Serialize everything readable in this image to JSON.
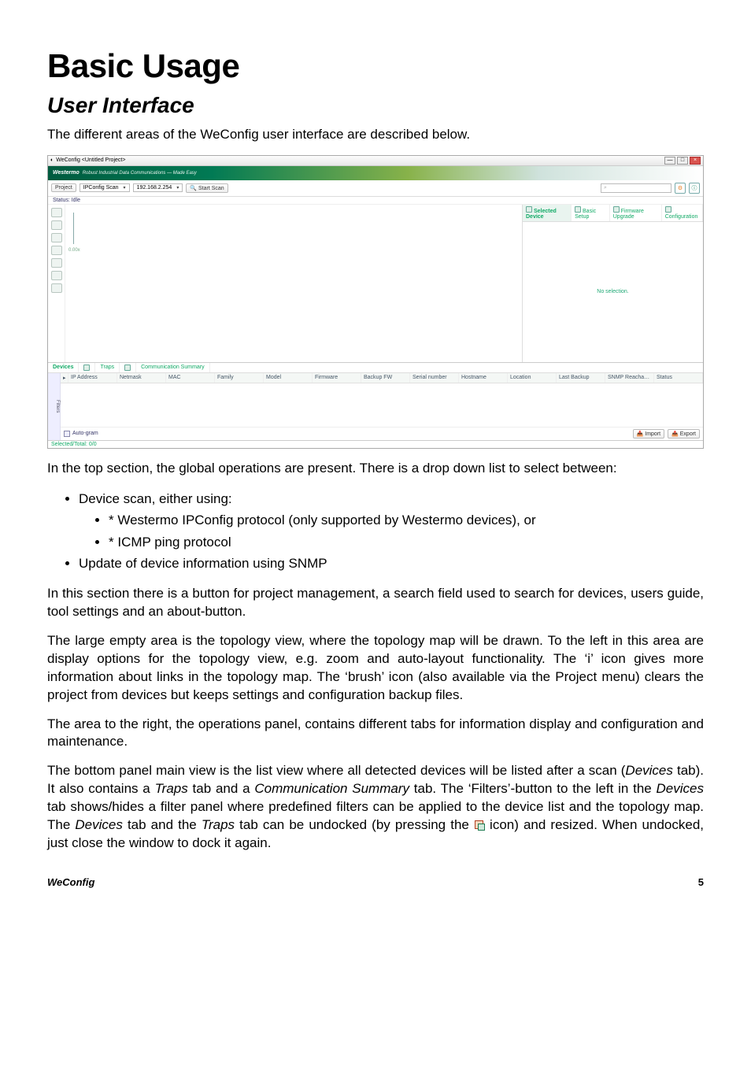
{
  "headings": {
    "h1": "Basic Usage",
    "h2": "User Interface"
  },
  "paragraphs": {
    "intro": "The different areas of the WeConfig user interface are described below.",
    "top_section_intro": "In the top section, the global operations are present. There is a drop down list to select between:",
    "top_section_note": "In this section there is a button for project management, a search field used to search for devices, users guide, tool settings and an about-button.",
    "large_area": "The large empty area is the topology view, where the topology map will be drawn. To the left in this area are display options for the topology view, e.g. zoom and auto-layout functionality. The ‘i’ icon gives more information about links in the topology map. The ‘brush’ icon (also available via the Project menu) clears the project from devices but keeps settings and configuration backup files.",
    "right_area": "The area to the right, the operations panel, contains different tabs for information display and configuration and maintenance.",
    "bottom_intro_1": "The bottom panel main view is the list view where all detected devices will be listed after a scan (",
    "bottom_devices_1": "Devices",
    "bottom_intro_2": " tab). It also contains a ",
    "bottom_traps": "Traps",
    "bottom_intro_3": " tab and a ",
    "bottom_comm": "Communication Summary",
    "bottom_intro_4": " tab. The ‘Filters’-button to the left in the ",
    "bottom_devices_2": "Devices",
    "bottom_intro_5": " tab shows/hides a filter panel where predefined filters can be applied to the device list and the topology map. The ",
    "bottom_devices_3": "Devices",
    "bottom_intro_6": " tab and the ",
    "bottom_traps_2": "Traps",
    "bottom_intro_7": " tab can be undocked (by pressing the ",
    "bottom_intro_8": " icon) and resized. When undocked, just close the window to dock it again."
  },
  "list": {
    "device_scan": "Device scan, either using:",
    "sub_ipconfig": "Westermo IPConfig protocol (only supported by Westermo devices), or",
    "sub_icmp": "ICMP ping protocol",
    "update_snmp": "Update of device information using SNMP"
  },
  "footer": {
    "product": "WeConfig",
    "page": "5"
  },
  "app": {
    "title": "WeConfig <Untitled Project>",
    "brand": "Westermo",
    "tagline": "Robust Industrial Data Communications — Made Easy",
    "toolbar": {
      "project": "Project",
      "scan_mode": "IPConfig Scan",
      "scan_target": "192.168.2.254",
      "start_scan": "Start Scan",
      "search_placeholder": " "
    },
    "status_idle": "Status:  Idle",
    "topo_scale": "0.00x",
    "right_tabs": {
      "selected": "Selected Device",
      "basic": "Basic Setup",
      "firmware": "Firmware Upgrade",
      "config": "Configuration"
    },
    "right_body": "No selection.",
    "bottom_tabs": {
      "devices": "Devices",
      "traps": "Traps",
      "comm": "Communication Summary"
    },
    "columns": [
      "IP Address",
      "Netmask",
      "MAC",
      "Family",
      "Model",
      "Firmware",
      "Backup FW",
      "Serial number",
      "Hostname",
      "Location",
      "Last Backup",
      "SNMP Reacha…",
      "Status"
    ],
    "filters_label": "Filters",
    "auto_gram": "Auto-gram",
    "import": "Import",
    "export": "Export",
    "footer_status": "Selected/Total: 0/0"
  }
}
